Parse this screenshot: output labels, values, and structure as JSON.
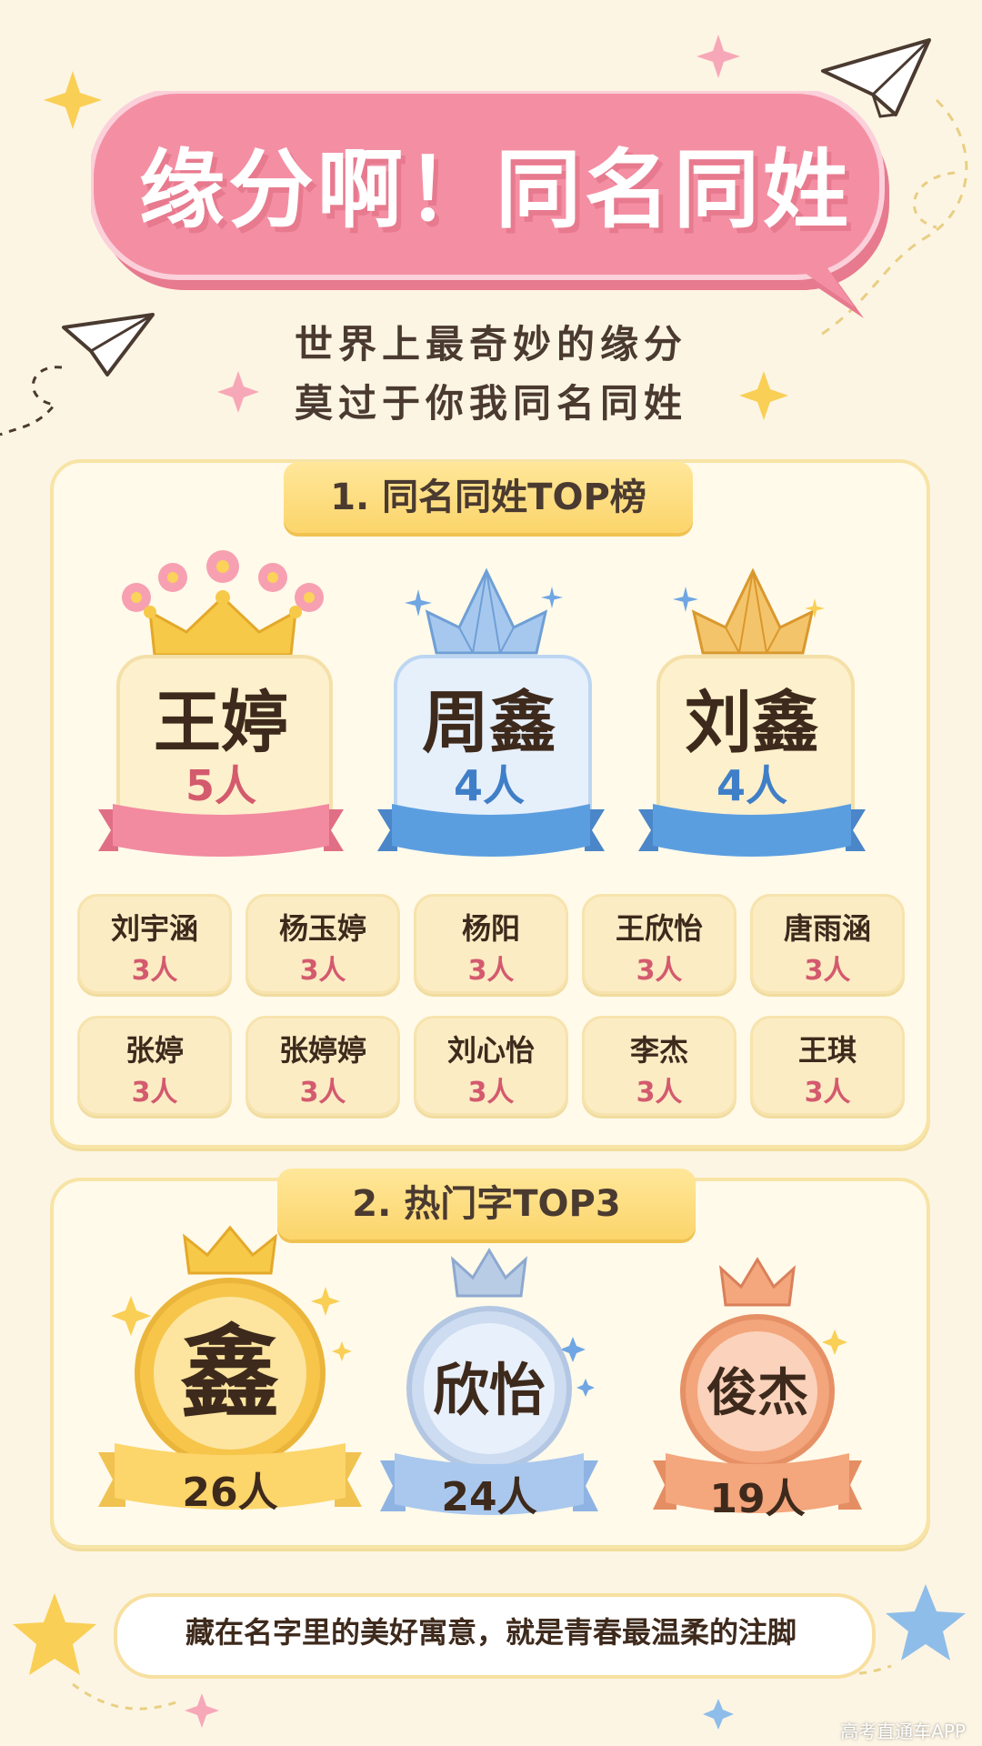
{
  "header": {
    "title": "缘分啊！同名同姓",
    "subtitle_lines": [
      "世界上最奇妙的缘分",
      "莫过于你我同名同姓"
    ]
  },
  "section1": {
    "label": "1. 同名同姓TOP榜",
    "top3": [
      {
        "name": "王婷",
        "count": "5人",
        "theme": "pink"
      },
      {
        "name": "周鑫",
        "count": "4人",
        "theme": "blue"
      },
      {
        "name": "刘鑫",
        "count": "4人",
        "theme": "blue"
      }
    ],
    "others": [
      {
        "name": "刘宇涵",
        "count": "3人"
      },
      {
        "name": "杨玉婷",
        "count": "3人"
      },
      {
        "name": "杨阳",
        "count": "3人"
      },
      {
        "name": "王欣怡",
        "count": "3人"
      },
      {
        "name": "唐雨涵",
        "count": "3人"
      },
      {
        "name": "张婷",
        "count": "3人"
      },
      {
        "name": "张婷婷",
        "count": "3人"
      },
      {
        "name": "刘心怡",
        "count": "3人"
      },
      {
        "name": "李杰",
        "count": "3人"
      },
      {
        "name": "王琪",
        "count": "3人"
      }
    ]
  },
  "section2": {
    "label": "2. 热门字TOP3",
    "items": [
      {
        "char": "鑫",
        "count": "26人"
      },
      {
        "char": "欣怡",
        "count": "24人"
      },
      {
        "char": "俊杰",
        "count": "19人"
      }
    ]
  },
  "footer": {
    "note": "藏在名字里的美好寓意，就是青春最温柔的注脚",
    "watermark": "高考直通车APP"
  },
  "colors": {
    "background": "#fdf5e4",
    "title_banner": "#f48fa3",
    "gold": "#f7c948",
    "pink_ribbon": "#f28aa0",
    "blue_ribbon": "#5b9ee0",
    "count_pink": "#d45a6e",
    "count_blue": "#3f7fc8"
  }
}
